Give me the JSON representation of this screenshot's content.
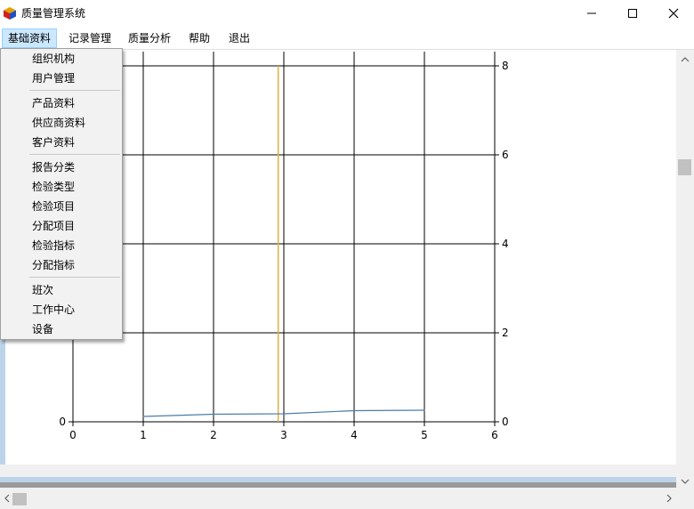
{
  "window": {
    "title": "质量管理系统"
  },
  "menubar": {
    "items": [
      {
        "label": "基础资料",
        "active": true
      },
      {
        "label": "记录管理",
        "active": false
      },
      {
        "label": "质量分析",
        "active": false
      },
      {
        "label": "帮助",
        "active": false
      },
      {
        "label": "退出",
        "active": false
      }
    ]
  },
  "dropdown": {
    "groups": [
      [
        "组织机构",
        "用户管理"
      ],
      [
        "产品资料",
        "供应商资料",
        "客户资料"
      ],
      [
        "报告分类",
        "检验类型",
        "检验项目",
        "分配项目",
        "检验指标",
        "分配指标"
      ],
      [
        "班次",
        "工作中心",
        "设备"
      ]
    ]
  },
  "chart_data": {
    "type": "line",
    "title": "",
    "xlabel": "",
    "ylabel": "",
    "xlim": [
      0,
      6
    ],
    "ylim_left": [
      0,
      8
    ],
    "ylim_right": [
      0,
      8
    ],
    "x_ticks": [
      "0",
      "1",
      "2",
      "3",
      "4",
      "5",
      "6"
    ],
    "y_ticks_left": [
      "0"
    ],
    "y_ticks_right": [
      "0",
      "2",
      "4",
      "6",
      "8"
    ],
    "grid": true,
    "series": [
      {
        "name": "",
        "color": "#4a7da8",
        "x": [
          1,
          2,
          3,
          4,
          5
        ],
        "y": [
          0.12,
          0.17,
          0.18,
          0.25,
          0.26
        ]
      }
    ],
    "marker_line": {
      "x": 2.92,
      "color": "#e0b040"
    }
  }
}
